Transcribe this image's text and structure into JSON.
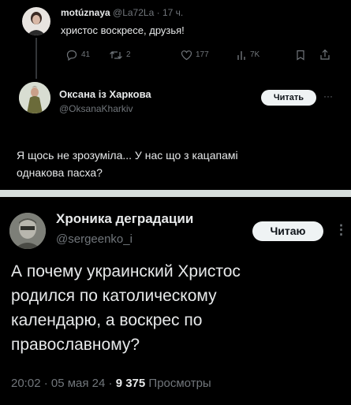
{
  "tweet1": {
    "name": "motúznaya",
    "handle": "@La72La",
    "time": "17 ч.",
    "text": "христос воскресе, друзья!",
    "replies": "41",
    "retweets": "2",
    "likes": "177",
    "views": "7K"
  },
  "tweet2": {
    "name": "Оксана із Харкова",
    "handle": "@OksanaKharkiv",
    "follow_label": "Читать",
    "more": "···",
    "text_line1": "Я щось не зрозуміла... У нас що з кацапамі",
    "text_line2": "однакова пасха?"
  },
  "tweet3": {
    "name": "Хроника деградации",
    "handle": "@sergeenko_i",
    "follow_label": "Читаю",
    "more": "⋮",
    "text_line1": "А почему украинский Христос",
    "text_line2": "родился по католическому",
    "text_line3": "календарю, а воскрес по",
    "text_line4": "православному?",
    "time": "20:02 · 05 мая 24 ·",
    "views_count": "9 375",
    "views_label": "Просмотры"
  },
  "colors": {
    "background": "#000000",
    "text": "#e7e9ea",
    "muted": "#71767b",
    "divider": "#d7dedc"
  }
}
